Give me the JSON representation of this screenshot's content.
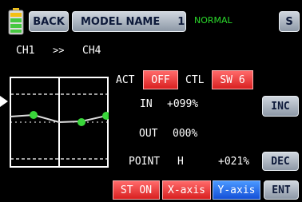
{
  "header": {
    "back_label": "BACK",
    "model_name_label": "MODEL NAME",
    "model_number": "1",
    "mode_label": "NORMAL",
    "s_label": "S"
  },
  "channel": {
    "from": "CH1",
    "arrow": ">>",
    "to": "CH4"
  },
  "controls": {
    "act_label": "ACT",
    "act_value": "OFF",
    "ctl_label": "CTL",
    "ctl_value": "SW 6",
    "in_label": "IN",
    "in_value": "+099%",
    "out_label": "OUT",
    "out_value": "000%",
    "point_label": "POINT",
    "point_id": "H",
    "point_value": "+021%"
  },
  "side_buttons": {
    "inc": "INC",
    "dec": "DEC",
    "ent": "ENT"
  },
  "bottom_buttons": {
    "st_on": "ST ON",
    "x_axis": "X-axis",
    "y_axis": "Y-axis"
  },
  "colors": {
    "accent_red": "#e83030",
    "accent_blue": "#1e5fe8",
    "mode_green": "#2bd92b",
    "curve_point": "#39d63a"
  },
  "icons": {
    "battery": "battery-icon",
    "pointer": "arrow-pointer-icon"
  }
}
